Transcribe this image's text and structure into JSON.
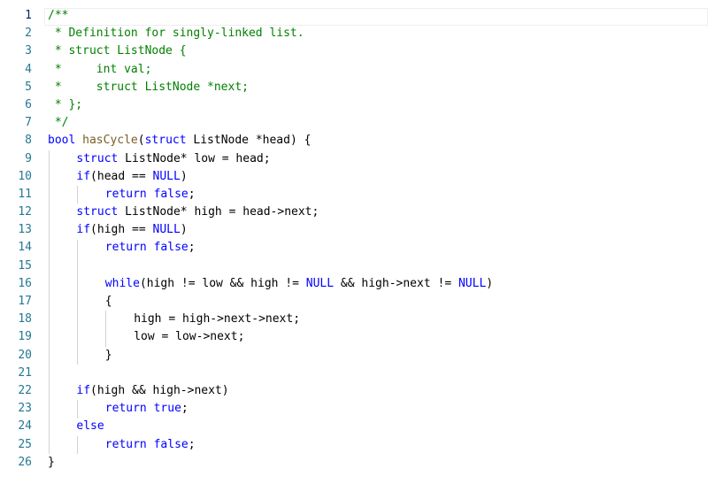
{
  "editor": {
    "active_line": 1,
    "lines": [
      {
        "n": "1",
        "indent": 0,
        "tokens": [
          {
            "t": "/**",
            "k": "comment"
          }
        ]
      },
      {
        "n": "2",
        "indent": 0,
        "tokens": [
          {
            "t": " * Definition for singly-linked list.",
            "k": "comment"
          }
        ]
      },
      {
        "n": "3",
        "indent": 0,
        "tokens": [
          {
            "t": " * struct ListNode {",
            "k": "comment"
          }
        ]
      },
      {
        "n": "4",
        "indent": 0,
        "tokens": [
          {
            "t": " *     int val;",
            "k": "comment"
          }
        ]
      },
      {
        "n": "5",
        "indent": 0,
        "tokens": [
          {
            "t": " *     struct ListNode *next;",
            "k": "comment"
          }
        ]
      },
      {
        "n": "6",
        "indent": 0,
        "tokens": [
          {
            "t": " * };",
            "k": "comment"
          }
        ]
      },
      {
        "n": "7",
        "indent": 0,
        "tokens": [
          {
            "t": " */",
            "k": "comment"
          }
        ]
      },
      {
        "n": "8",
        "indent": 0,
        "tokens": [
          {
            "t": "bool",
            "k": "kw"
          },
          {
            "t": " ",
            "k": ""
          },
          {
            "t": "hasCycle",
            "k": "fn"
          },
          {
            "t": "(",
            "k": ""
          },
          {
            "t": "struct",
            "k": "kw"
          },
          {
            "t": " ListNode *head) {",
            "k": ""
          }
        ]
      },
      {
        "n": "9",
        "indent": 1,
        "tokens": [
          {
            "t": "struct",
            "k": "kw"
          },
          {
            "t": " ListNode* low = head;",
            "k": ""
          }
        ]
      },
      {
        "n": "10",
        "indent": 1,
        "tokens": [
          {
            "t": "if",
            "k": "kw"
          },
          {
            "t": "(head == ",
            "k": ""
          },
          {
            "t": "NULL",
            "k": "kw"
          },
          {
            "t": ")",
            "k": ""
          }
        ]
      },
      {
        "n": "11",
        "indent": 2,
        "tokens": [
          {
            "t": "return",
            "k": "kw"
          },
          {
            "t": " ",
            "k": ""
          },
          {
            "t": "false",
            "k": "kw"
          },
          {
            "t": ";",
            "k": ""
          }
        ]
      },
      {
        "n": "12",
        "indent": 1,
        "tokens": [
          {
            "t": "struct",
            "k": "kw"
          },
          {
            "t": " ListNode* high = head->next;",
            "k": ""
          }
        ]
      },
      {
        "n": "13",
        "indent": 1,
        "tokens": [
          {
            "t": "if",
            "k": "kw"
          },
          {
            "t": "(high == ",
            "k": ""
          },
          {
            "t": "NULL",
            "k": "kw"
          },
          {
            "t": ")",
            "k": ""
          }
        ]
      },
      {
        "n": "14",
        "indent": 2,
        "tokens": [
          {
            "t": "return",
            "k": "kw"
          },
          {
            "t": " ",
            "k": ""
          },
          {
            "t": "false",
            "k": "kw"
          },
          {
            "t": ";",
            "k": ""
          }
        ]
      },
      {
        "n": "15",
        "indent": 0,
        "tokens": []
      },
      {
        "n": "16",
        "indent": 2,
        "tokens": [
          {
            "t": "while",
            "k": "kw"
          },
          {
            "t": "(high != low && high != ",
            "k": ""
          },
          {
            "t": "NULL",
            "k": "kw"
          },
          {
            "t": " && high->next != ",
            "k": ""
          },
          {
            "t": "NULL",
            "k": "kw"
          },
          {
            "t": ")",
            "k": ""
          }
        ]
      },
      {
        "n": "17",
        "indent": 2,
        "tokens": [
          {
            "t": "{",
            "k": ""
          }
        ]
      },
      {
        "n": "18",
        "indent": 3,
        "tokens": [
          {
            "t": "high = high->next->next;",
            "k": ""
          }
        ]
      },
      {
        "n": "19",
        "indent": 3,
        "tokens": [
          {
            "t": "low = low->next;",
            "k": ""
          }
        ]
      },
      {
        "n": "20",
        "indent": 2,
        "tokens": [
          {
            "t": "}",
            "k": ""
          }
        ]
      },
      {
        "n": "21",
        "indent": 0,
        "tokens": []
      },
      {
        "n": "22",
        "indent": 1,
        "tokens": [
          {
            "t": "if",
            "k": "kw"
          },
          {
            "t": "(high && high->next)",
            "k": ""
          }
        ]
      },
      {
        "n": "23",
        "indent": 2,
        "tokens": [
          {
            "t": "return",
            "k": "kw"
          },
          {
            "t": " ",
            "k": ""
          },
          {
            "t": "true",
            "k": "kw"
          },
          {
            "t": ";",
            "k": ""
          }
        ]
      },
      {
        "n": "24",
        "indent": 1,
        "tokens": [
          {
            "t": "else",
            "k": "kw"
          }
        ]
      },
      {
        "n": "25",
        "indent": 2,
        "tokens": [
          {
            "t": "return",
            "k": "kw"
          },
          {
            "t": " ",
            "k": ""
          },
          {
            "t": "false",
            "k": "kw"
          },
          {
            "t": ";",
            "k": ""
          }
        ]
      },
      {
        "n": "26",
        "indent": 0,
        "tokens": [
          {
            "t": "}",
            "k": ""
          }
        ]
      }
    ],
    "guides": [
      {
        "level": 1,
        "from": 9,
        "to": 25
      },
      {
        "level": 2,
        "from": 11,
        "to": 11
      },
      {
        "level": 2,
        "from": 14,
        "to": 20
      },
      {
        "level": 3,
        "from": 18,
        "to": 19
      },
      {
        "level": 2,
        "from": 23,
        "to": 23
      },
      {
        "level": 2,
        "from": 25,
        "to": 25
      }
    ]
  },
  "colors": {
    "comment": "#008000",
    "keyword": "#0000ff",
    "function": "#795e26",
    "line_number": "#237893",
    "active_line_number": "#0b216f",
    "indent_guide": "#d3d3d3"
  }
}
